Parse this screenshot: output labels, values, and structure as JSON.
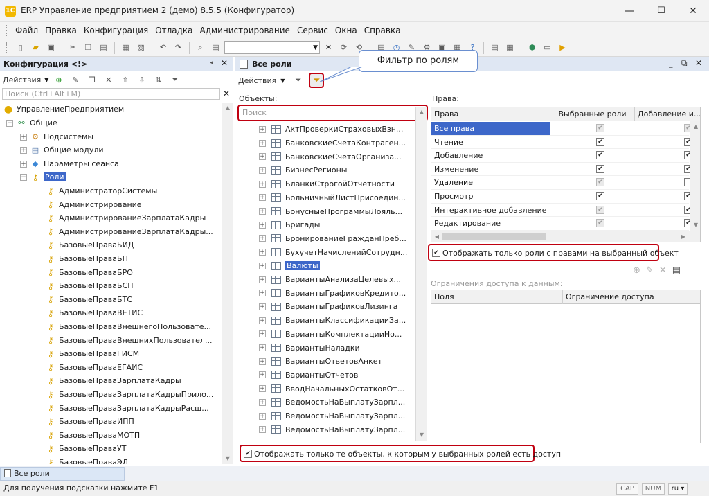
{
  "window": {
    "title": "ERP Управление предприятием 2 (демо) 8.5.5 (Конфигуратор)",
    "controls": {
      "minimize": "—",
      "maximize": "☐",
      "close": "✕"
    }
  },
  "menu": [
    "Файл",
    "Правка",
    "Конфигурация",
    "Отладка",
    "Администрирование",
    "Сервис",
    "Окна",
    "Справка"
  ],
  "left_panel": {
    "title": "Конфигурация <!>",
    "actions_label": "Действия",
    "search_placeholder": "Поиск (Ctrl+Alt+M)",
    "tree_root": "УправлениеПредприятием",
    "tree_common": "Общие",
    "tree_nodes": [
      "Подсистемы",
      "Общие модули",
      "Параметры сеанса"
    ],
    "tree_roles": "Роли",
    "roles": [
      "АдминистраторСистемы",
      "Администрирование",
      "АдминистрированиеЗарплатаКадры",
      "АдминистрированиеЗарплатаКадры...",
      "БазовыеПраваБИД",
      "БазовыеПраваБП",
      "БазовыеПраваБРО",
      "БазовыеПраваБСП",
      "БазовыеПраваБТС",
      "БазовыеПраваВЕТИС",
      "БазовыеПраваВнешнегоПользовате...",
      "БазовыеПраваВнешнихПользовател...",
      "БазовыеПраваГИСМ",
      "БазовыеПраваЕГАИС",
      "БазовыеПраваЗарплатаКадры",
      "БазовыеПраваЗарплатаКадрыПрило...",
      "БазовыеПраваЗарплатаКадрыРасш...",
      "БазовыеПраваИПП",
      "БазовыеПраваМОТП",
      "БазовыеПраваУТ",
      "БазовыеПраваЭД"
    ]
  },
  "right_panel": {
    "title": "Все роли",
    "actions_label": "Действия",
    "tooltip": "Фильтр по ролям",
    "objects_label": "Объекты:",
    "search_placeholder": "Поиск",
    "objects": [
      "АктПроверкиСтраховыхВзн...",
      "БанковскиеСчетаКонтраген...",
      "БанковскиеСчетаОрганиза...",
      "БизнесРегионы",
      "БланкиСтрогойОтчетности",
      "БольничныйЛистПрисоедин...",
      "БонусныеПрограммыЛояль...",
      "Бригады",
      "БронированиеГражданПреб...",
      "БухучетНачисленийСотрудн...",
      "Валюты",
      "ВариантыАнализаЦелевых...",
      "ВариантыГрафиковКредито...",
      "ВариантыГрафиковЛизинга",
      "ВариантыКлассификацииЗа...",
      "ВариантыКомплектацииНо...",
      "ВариантыНаладки",
      "ВариантыОтветовАнкет",
      "ВариантыОтчетов",
      "ВводНачальныхОстатковОт...",
      "ВедомостьНаВыплатуЗарпл...",
      "ВедомостьНаВыплатуЗарпл...",
      "ВедомостьНаВыплатуЗарпл..."
    ],
    "selected_object": "Валюты",
    "rights_label": "Права:",
    "rights_columns": [
      "Права",
      "Выбранные роли",
      "Добавление и..."
    ],
    "rights": [
      {
        "name": "Все права",
        "selected": true,
        "col1": "gray",
        "col2": "gray"
      },
      {
        "name": "Чтение",
        "selected": false,
        "col1": "checked",
        "col2": "checked"
      },
      {
        "name": "Добавление",
        "selected": false,
        "col1": "checked",
        "col2": "checked"
      },
      {
        "name": "Изменение",
        "selected": false,
        "col1": "checked",
        "col2": "checked"
      },
      {
        "name": "Удаление",
        "selected": false,
        "col1": "gray",
        "col2": "empty"
      },
      {
        "name": "Просмотр",
        "selected": false,
        "col1": "checked",
        "col2": "checked"
      },
      {
        "name": "Интерактивное добавление",
        "selected": false,
        "col1": "gray",
        "col2": "checked"
      },
      {
        "name": "Редактирование",
        "selected": false,
        "col1": "gray",
        "col2": "checked"
      }
    ],
    "show_roles_with_rights": "Отображать только роли с правами на выбранный объект",
    "data_restrictions_label": "Ограничения доступа к данным:",
    "restriction_columns": [
      "Поля",
      "Ограничение доступа"
    ],
    "show_objects_with_access": "Отображать только те объекты, к которым у выбранных ролей есть доступ"
  },
  "taskbar_tab": "Все роли",
  "status": {
    "hint": "Для получения подсказки нажмите F1",
    "caps": "CAP",
    "num": "NUM",
    "lang": "ru ▾"
  },
  "colors": {
    "highlight": "#c00010",
    "selection": "#3d67c9",
    "panel_header": "#dfe7f3"
  }
}
